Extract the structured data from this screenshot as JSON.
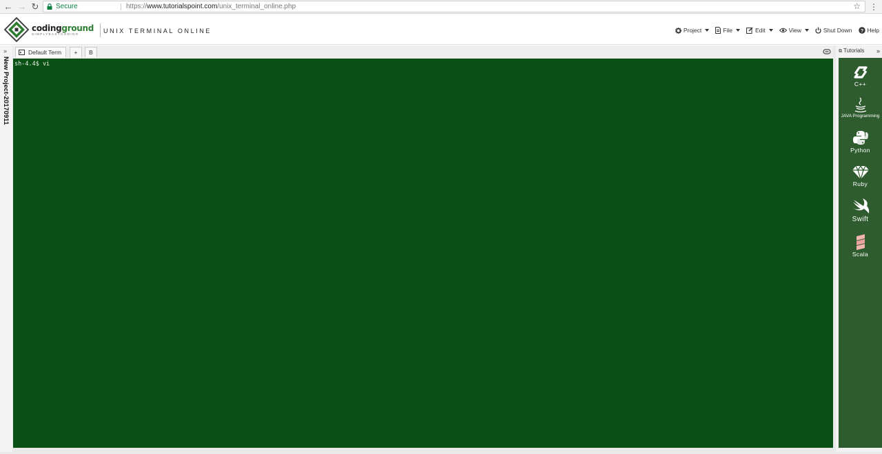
{
  "browser": {
    "back_icon": "arrow-left-icon",
    "forward_icon": "arrow-right-icon",
    "reload_icon": "reload-icon",
    "secure_label": "Secure",
    "url_scheme": "https://",
    "url_host": "www.tutorialspoint.com",
    "url_path": "/unix_terminal_online.php",
    "bookmark_icon": "star-icon",
    "menu_icon": "vertical-dots-icon"
  },
  "header": {
    "logo_word_a": "coding",
    "logo_word_b": "ground",
    "logo_tagline": "SIMPLYEASYCODING",
    "title": "UNIX TERMINAL ONLINE",
    "menu": {
      "project": "Project",
      "file": "File",
      "edit": "Edit",
      "view": "View",
      "shutdown": "Shut Down",
      "help": "Help"
    }
  },
  "sidebar": {
    "expand_icon": "double-chevron-right-icon",
    "project_name": "New Project-20170911"
  },
  "tabs": {
    "default_term": "Default Term",
    "add": "+",
    "b": "B"
  },
  "terminal": {
    "prompt_line": "sh-4.4$ vi",
    "background": "#0a5015"
  },
  "tutorials": {
    "title": "Tutorials",
    "items": [
      {
        "label": "C++",
        "icon": "cpp-icon"
      },
      {
        "label": "JAVA Programming",
        "icon": "java-cup-icon"
      },
      {
        "label": "Python",
        "icon": "python-icon"
      },
      {
        "label": "Ruby",
        "icon": "ruby-gem-icon"
      },
      {
        "label": "Swift",
        "icon": "swift-bird-icon"
      },
      {
        "label": "Scala",
        "icon": "scala-icon"
      }
    ]
  },
  "colors": {
    "accent_green": "#2e5c2f",
    "terminal_bg": "#0a5015",
    "secure_green": "#0b8043"
  }
}
